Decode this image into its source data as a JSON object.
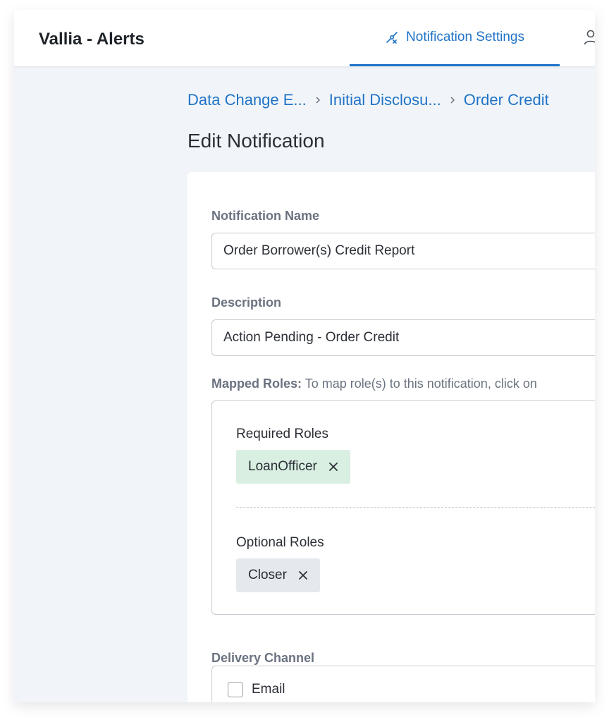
{
  "app": {
    "title": "Vallia - Alerts"
  },
  "nav": {
    "active_tab": "Notification Settings"
  },
  "breadcrumb": [
    "Data Change E...",
    "Initial Disclosu...",
    "Order Credit"
  ],
  "page": {
    "title": "Edit Notification"
  },
  "form": {
    "name_label": "Notification Name",
    "name_value": "Order Borrower(s) Credit Report",
    "description_label": "Description",
    "description_value": "Action Pending - Order Credit",
    "mapped_roles_label": "Mapped Roles:",
    "mapped_roles_hint": "To map role(s) to this notification, click on",
    "required_roles_label": "Required Roles",
    "required_roles": [
      "LoanOfficer"
    ],
    "optional_roles_label": "Optional Roles",
    "optional_roles": [
      "Closer"
    ],
    "delivery_channel_label": "Delivery Channel",
    "channels": [
      {
        "label": "Email",
        "checked": false
      }
    ]
  },
  "colors": {
    "accent": "#1f73c7",
    "required_chip": "#d8efe2",
    "optional_chip": "#e5e9ee",
    "background": "#f1f5f9"
  },
  "icons": {
    "nav_tab": "notification-settings-icon",
    "user": "user-icon",
    "breadcrumb_separator": "chevron-right-icon",
    "chip_remove": "close-icon"
  }
}
